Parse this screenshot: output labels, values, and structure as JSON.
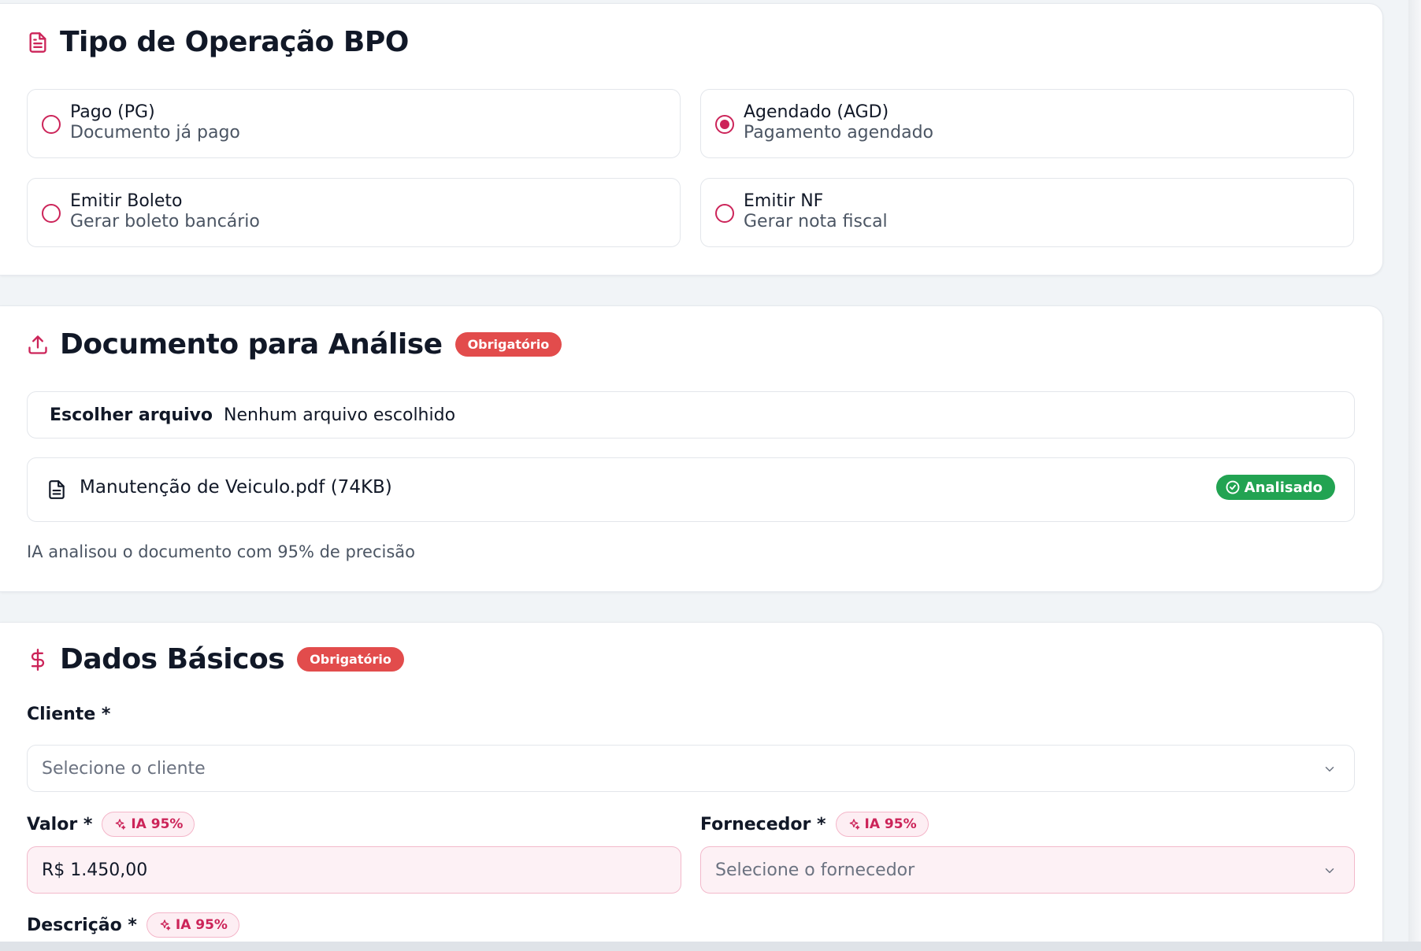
{
  "tipo_operacao": {
    "title": "Tipo de Operação BPO",
    "options": [
      {
        "title": "Pago (PG)",
        "desc": "Documento já pago",
        "checked": false
      },
      {
        "title": "Agendado (AGD)",
        "desc": "Pagamento agendado",
        "checked": true
      },
      {
        "title": "Emitir Boleto",
        "desc": "Gerar boleto bancário",
        "checked": false
      },
      {
        "title": "Emitir NF",
        "desc": "Gerar nota fiscal",
        "checked": false
      }
    ]
  },
  "documento": {
    "title": "Documento para Análise",
    "required_badge": "Obrigatório",
    "choose_label": "Escolher arquivo",
    "no_file_label": "Nenhum arquivo escolhido",
    "file_name": "Manutenção de Veiculo.pdf (74KB)",
    "status_badge": "Analisado",
    "ai_note": "IA analisou o documento com 95% de precisão"
  },
  "dados_basicos": {
    "title": "Dados Básicos",
    "required_badge": "Obrigatório",
    "cliente_label": "Cliente *",
    "cliente_placeholder": "Selecione o cliente",
    "valor_label": "Valor *",
    "valor_ai": "IA 95%",
    "valor_value": "R$ 1.450,00",
    "fornecedor_label": "Fornecedor *",
    "fornecedor_ai": "IA 95%",
    "fornecedor_placeholder": "Selecione o fornecedor",
    "descricao_label": "Descrição *",
    "descricao_ai": "IA 95%"
  },
  "colors": {
    "accent": "#cc2459",
    "required": "#e24c4c",
    "success": "#22a352"
  },
  "icons": {
    "section1": "file-text-icon",
    "section2": "upload-icon",
    "section3": "dollar-icon",
    "file": "file-icon",
    "check": "check-circle-icon",
    "ai": "sparkles-icon",
    "chevron": "chevron-down-icon"
  }
}
